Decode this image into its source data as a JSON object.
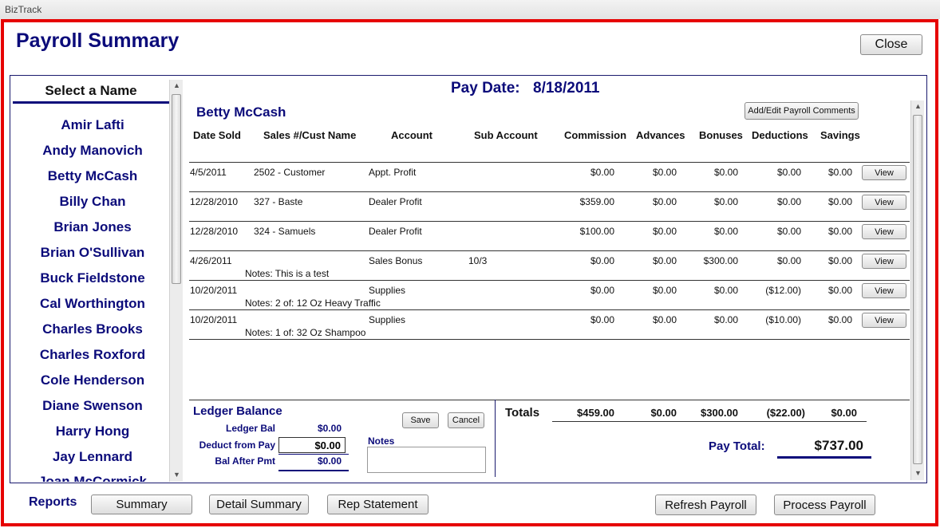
{
  "window": {
    "title": "BizTrack"
  },
  "page": {
    "title": "Payroll Summary",
    "close_label": "Close"
  },
  "names": {
    "header": "Select a Name",
    "items": [
      "Amir Lafti",
      "Andy Manovich",
      "Betty McCash",
      "Billy Chan",
      "Brian Jones",
      "Brian O'Sullivan",
      "Buck Fieldstone",
      "Cal Worthington",
      "Charles Brooks",
      "Charles Roxford",
      "Cole Henderson",
      "Diane Swenson",
      "Harry Hong",
      "Jay Lennard",
      "Joan McCormick"
    ],
    "selected": "Betty McCash"
  },
  "pay_date": {
    "label": "Pay Date:",
    "value": "8/18/2011"
  },
  "employee": {
    "name": "Betty McCash",
    "comments_button": "Add/Edit Payroll Comments"
  },
  "table": {
    "columns": [
      "Date Sold",
      "Sales #/Cust Name",
      "Account",
      "Sub Account",
      "Commission",
      "Advances",
      "Bonuses",
      "Deductions",
      "Savings"
    ],
    "view_label": "View",
    "rows": [
      {
        "date": "4/5/2011",
        "sales": "2502 - Customer",
        "account": "Appt. Profit",
        "sub": "",
        "commission": "$0.00",
        "advances": "$0.00",
        "bonuses": "$0.00",
        "deductions": "$0.00",
        "savings": "$0.00",
        "note": ""
      },
      {
        "date": "12/28/2010",
        "sales": "327 - Baste",
        "account": "Dealer Profit",
        "sub": "",
        "commission": "$359.00",
        "advances": "$0.00",
        "bonuses": "$0.00",
        "deductions": "$0.00",
        "savings": "$0.00",
        "note": ""
      },
      {
        "date": "12/28/2010",
        "sales": "324 - Samuels",
        "account": "Dealer Profit",
        "sub": "",
        "commission": "$100.00",
        "advances": "$0.00",
        "bonuses": "$0.00",
        "deductions": "$0.00",
        "savings": "$0.00",
        "note": ""
      },
      {
        "date": "4/26/2011",
        "sales": "",
        "account": "Sales Bonus",
        "sub": "10/3",
        "commission": "$0.00",
        "advances": "$0.00",
        "bonuses": "$300.00",
        "deductions": "$0.00",
        "savings": "$0.00",
        "note": "Notes: This is a test"
      },
      {
        "date": "10/20/2011",
        "sales": "",
        "account": "Supplies",
        "sub": "",
        "commission": "$0.00",
        "advances": "$0.00",
        "bonuses": "$0.00",
        "deductions": "($12.00)",
        "savings": "$0.00",
        "note": "Notes:  2 of: 12 Oz Heavy  Traffic"
      },
      {
        "date": "10/20/2011",
        "sales": "",
        "account": "Supplies",
        "sub": "",
        "commission": "$0.00",
        "advances": "$0.00",
        "bonuses": "$0.00",
        "deductions": "($10.00)",
        "savings": "$0.00",
        "note": "Notes:  1 of: 32 Oz Shampoo"
      }
    ]
  },
  "ledger": {
    "title": "Ledger Balance",
    "bal_label": "Ledger Bal",
    "bal_value": "$0.00",
    "deduct_label": "Deduct from Pay",
    "deduct_value": "$0.00",
    "after_label": "Bal After Pmt",
    "after_value": "$0.00",
    "save_label": "Save",
    "cancel_label": "Cancel",
    "notes_label": "Notes",
    "notes_value": ""
  },
  "totals": {
    "label": "Totals",
    "commission": "$459.00",
    "advances": "$0.00",
    "bonuses": "$300.00",
    "deductions": "($22.00)",
    "savings": "$0.00",
    "pay_total_label": "Pay Total:",
    "pay_total_value": "$737.00"
  },
  "footer": {
    "reports_label": "Reports",
    "summary": "Summary",
    "detail_summary": "Detail Summary",
    "rep_statement": "Rep Statement",
    "refresh": "Refresh Payroll",
    "process": "Process Payroll"
  }
}
